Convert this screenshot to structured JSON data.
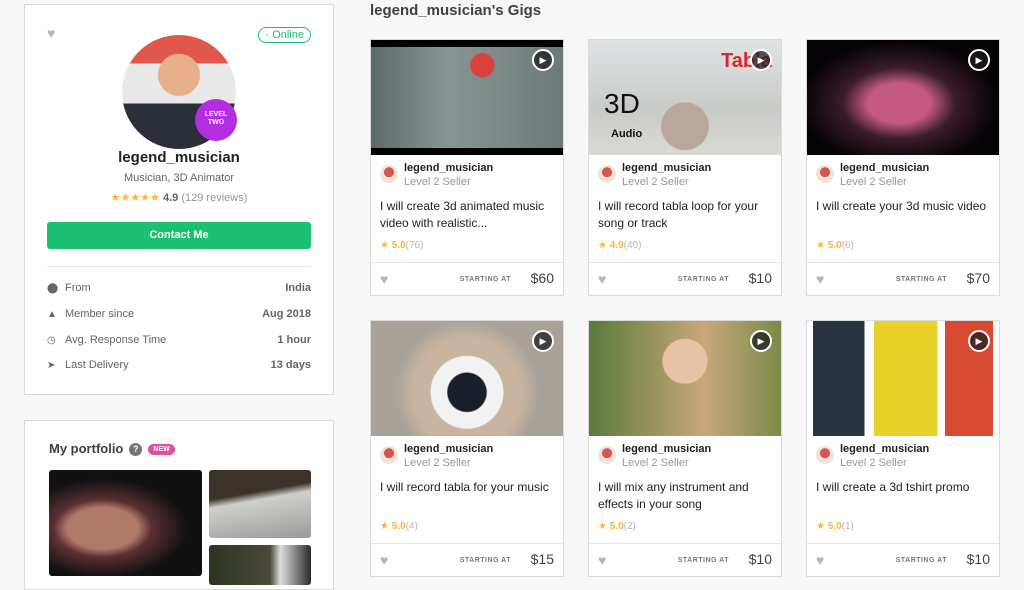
{
  "profile": {
    "status": "· Online",
    "level_badge": [
      "LEVEL",
      "TWO"
    ],
    "username": "legend_musician",
    "title": "Musician, 3D Animator",
    "stars": 5,
    "rating": "4.9",
    "reviews": "(129 reviews)",
    "contact_label": "Contact Me",
    "stats": [
      {
        "icon": "location-pin-icon",
        "label": "From",
        "value": "India"
      },
      {
        "icon": "user-icon",
        "label": "Member since",
        "value": "Aug 2018"
      },
      {
        "icon": "clock-icon",
        "label": "Avg. Response Time",
        "value": "1 hour"
      },
      {
        "icon": "paper-plane-icon",
        "label": "Last Delivery",
        "value": "13 days"
      }
    ]
  },
  "portfolio": {
    "title": "My portfolio",
    "help": "?",
    "badge": "NEW"
  },
  "gigs_section": {
    "title": "legend_musician's Gigs"
  },
  "gigs": [
    {
      "seller": "legend_musician",
      "level": "Level 2 Seller",
      "title": "I will create 3d animated music video with realistic...",
      "rating": "5.0",
      "count": "(76)",
      "starting": "STARTING AT",
      "price": "$60"
    },
    {
      "seller": "legend_musician",
      "level": "Level 2 Seller",
      "title": "I will record tabla loop for your song or track",
      "rating": "4.9",
      "count": "(40)",
      "starting": "STARTING AT",
      "price": "$10",
      "overlay": {
        "big": "3D",
        "small": "Audio",
        "brand": "Tabla"
      }
    },
    {
      "seller": "legend_musician",
      "level": "Level 2 Seller",
      "title": "I will create your 3d music video",
      "rating": "5.0",
      "count": "(6)",
      "starting": "STARTING AT",
      "price": "$70"
    },
    {
      "seller": "legend_musician",
      "level": "Level 2 Seller",
      "title": "I will record tabla for your music",
      "rating": "5.0",
      "count": "(4)",
      "starting": "STARTING AT",
      "price": "$15"
    },
    {
      "seller": "legend_musician",
      "level": "Level 2 Seller",
      "title": "I will mix any instrument and effects in your song",
      "rating": "5.0",
      "count": "(2)",
      "starting": "STARTING AT",
      "price": "$10"
    },
    {
      "seller": "legend_musician",
      "level": "Level 2 Seller",
      "title": "I will create a 3d tshirt promo",
      "rating": "5.0",
      "count": "(1)",
      "starting": "STARTING AT",
      "price": "$10"
    }
  ]
}
